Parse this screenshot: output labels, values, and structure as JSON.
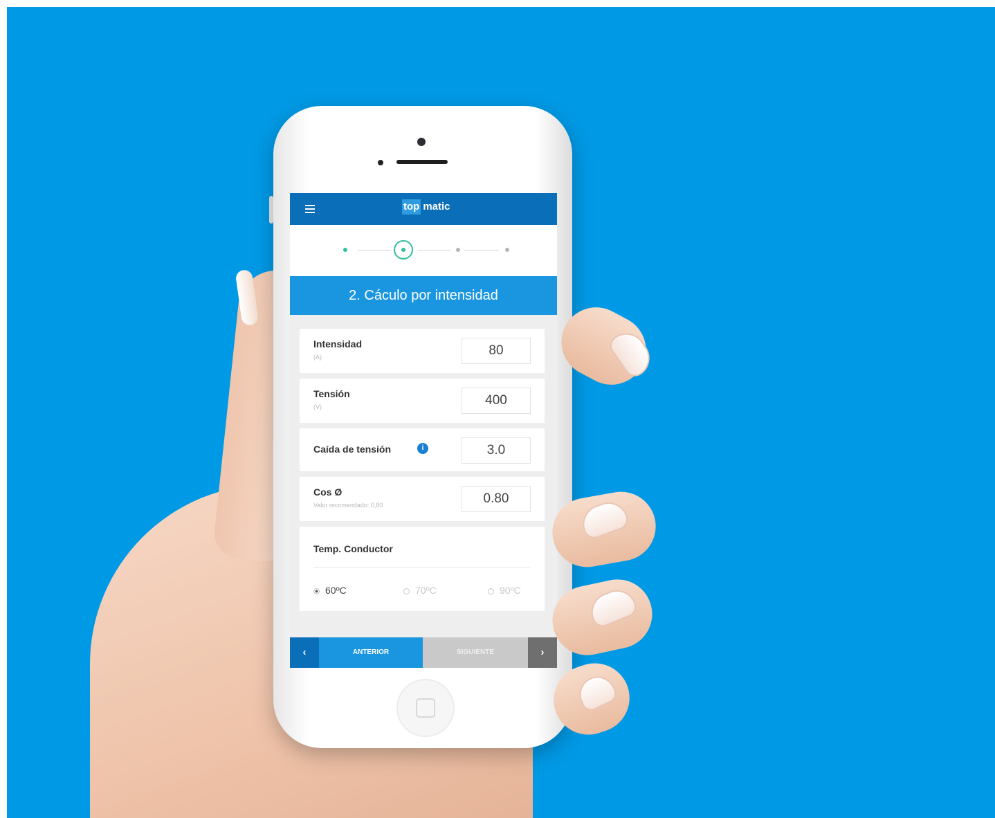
{
  "app": {
    "logo_top": "top",
    "logo_matic": "matic",
    "brand_color": "#0a6fb8",
    "accent_color": "#1a96e0",
    "step_active_color": "#2fbf9c"
  },
  "stepper": {
    "total_steps": 4,
    "current_step": 2
  },
  "section": {
    "title": "2. Cáculo por intensidad"
  },
  "fields": {
    "intensidad": {
      "label": "Intensidad",
      "unit": "(A)",
      "value": "80"
    },
    "tension": {
      "label": "Tensión",
      "unit": "(V)",
      "value": "400"
    },
    "caida": {
      "label": "Caída de tensión",
      "info_icon": "i",
      "value": "3.0"
    },
    "cos": {
      "label": "Cos Ø",
      "hint": "Valor recomendado: 0,80",
      "value": "0.80"
    }
  },
  "temperature": {
    "label": "Temp. Conductor",
    "options": [
      {
        "label": "60ºC",
        "selected": true
      },
      {
        "label": "70ºC",
        "selected": false
      },
      {
        "label": "90ºC",
        "selected": false
      }
    ]
  },
  "nav": {
    "prev_arrow": "‹",
    "prev_label": "ANTERIOR",
    "next_label": "SIGUIENTE",
    "next_arrow": "›"
  }
}
